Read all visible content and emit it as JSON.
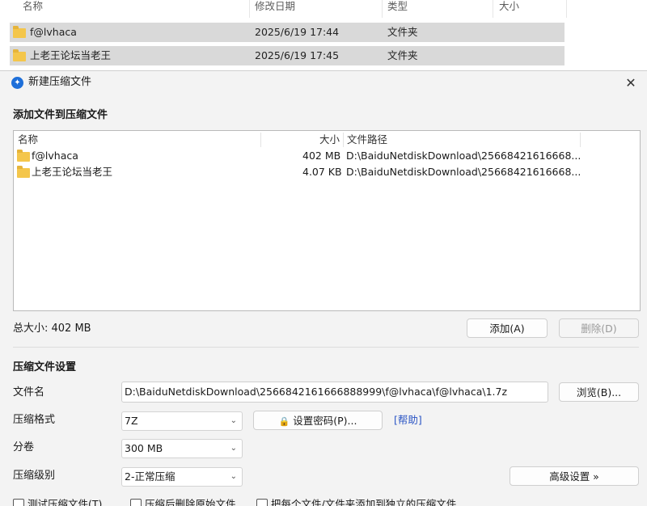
{
  "explorer": {
    "columns": {
      "name": "名称",
      "modified": "修改日期",
      "type": "类型",
      "size": "大小"
    },
    "rows": [
      {
        "name": "f@lvhaca",
        "modified": "2025/6/19 17:44",
        "type": "文件夹"
      },
      {
        "name": "上老王论坛当老王",
        "modified": "2025/6/19 17:45",
        "type": "文件夹"
      }
    ]
  },
  "dialog": {
    "title": "新建压缩文件",
    "close_glyph": "✕",
    "app_icon_glyph": "✦",
    "add_section": "添加文件到压缩文件",
    "list": {
      "columns": {
        "name": "名称",
        "size": "大小",
        "path": "文件路径"
      },
      "rows": [
        {
          "name": "f@lvhaca",
          "size": "402 MB",
          "path": "D:\\BaiduNetdiskDownload\\25668421616668..."
        },
        {
          "name": "上老王论坛当老王",
          "size": "4.07 KB",
          "path": "D:\\BaiduNetdiskDownload\\25668421616668..."
        }
      ]
    },
    "total_size": "总大小: 402 MB",
    "add_button": "添加(A)",
    "delete_button": "删除(D)",
    "settings_section": "压缩文件设置",
    "filename_label": "文件名",
    "filename_value": "D:\\BaiduNetdiskDownload\\2566842161666888999\\f@lvhaca\\f@lvhaca\\1.7z",
    "browse_button": "浏览(B)...",
    "format_label": "压缩格式",
    "format_value": "7Z",
    "password_button": "设置密码(P)...",
    "help_link": "[帮助]",
    "split_label": "分卷",
    "split_value": "300 MB",
    "level_label": "压缩级别",
    "level_value": "2-正常压缩",
    "advanced_button": "高级设置 »",
    "checkboxes": [
      {
        "label": "测试压缩文件(T)",
        "checked": false
      },
      {
        "label": "压缩后删除原始文件",
        "checked": false
      },
      {
        "label": "把每个文件/文件夹添加到独立的压缩文件",
        "checked": false
      }
    ]
  }
}
